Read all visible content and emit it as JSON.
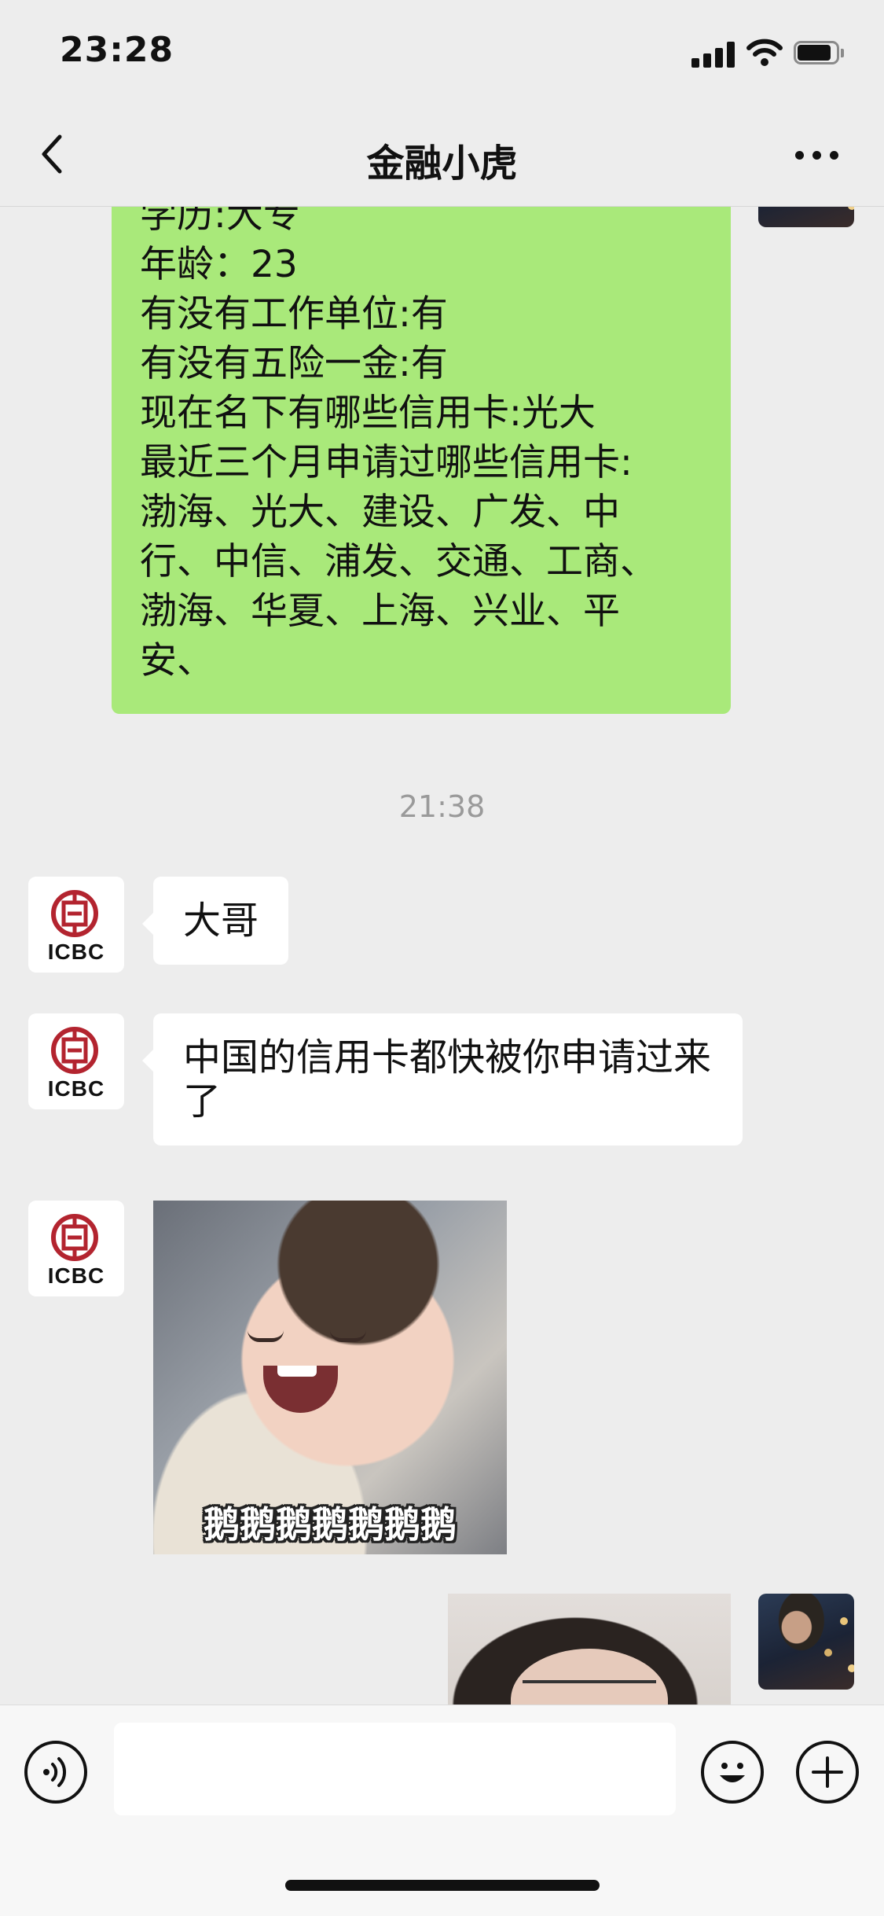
{
  "status_bar": {
    "time": "23:28"
  },
  "nav": {
    "title": "金融小虎",
    "back_icon": "chevron-left-icon",
    "more_icon": "ellipsis-icon"
  },
  "messages": {
    "sent_info_lines": [
      "学历:大专",
      "年龄：23",
      "有没有工作单位:有",
      "有没有五险一金:有",
      "现在名下有哪些信用卡:光大",
      "最近三个月申请过哪些信用卡:",
      "渤海、光大、建设、广发、中",
      "行、中信、浦发、交通、工商、",
      "渤海、华夏、上海、兴业、平",
      "安、"
    ],
    "timestamp": "21:38",
    "contact_avatar_label": "ICBC",
    "received_1": "大哥",
    "received_2": "中国的信用卡都快被你申请过来了",
    "sticker_caption": "鹅鹅鹅鹅鹅鹅鹅"
  },
  "input_bar": {
    "placeholder": ""
  },
  "colors": {
    "sent_bubble": "#a9e97a",
    "received_bubble": "#ffffff",
    "background": "#ededed",
    "icbc_red": "#b3242f"
  }
}
